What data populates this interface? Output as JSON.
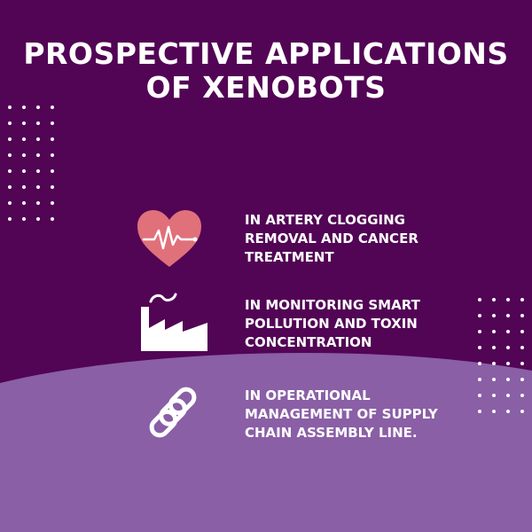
{
  "title": {
    "line1": "PROSPECTIVE APPLICATIONS",
    "line2": "OF XENOBOTS"
  },
  "colors": {
    "background": "#520455",
    "lower_band": "#8a5fa6",
    "heart": "#e0707a",
    "text": "#ffffff",
    "dots": "#ffffff"
  },
  "items": [
    {
      "icon": "heart-pulse-icon",
      "lines": [
        "IN ARTERY CLOGGING",
        "REMOVAL AND CANCER",
        "TREATMENT"
      ]
    },
    {
      "icon": "factory-icon",
      "lines": [
        "IN MONITORING SMART",
        "POLLUTION AND TOXIN",
        "CONCENTRATION"
      ]
    },
    {
      "icon": "chain-link-icon",
      "lines": [
        "IN OPERATIONAL",
        "MANAGEMENT OF SUPPLY",
        "CHAIN ASSEMBLY LINE."
      ]
    }
  ]
}
